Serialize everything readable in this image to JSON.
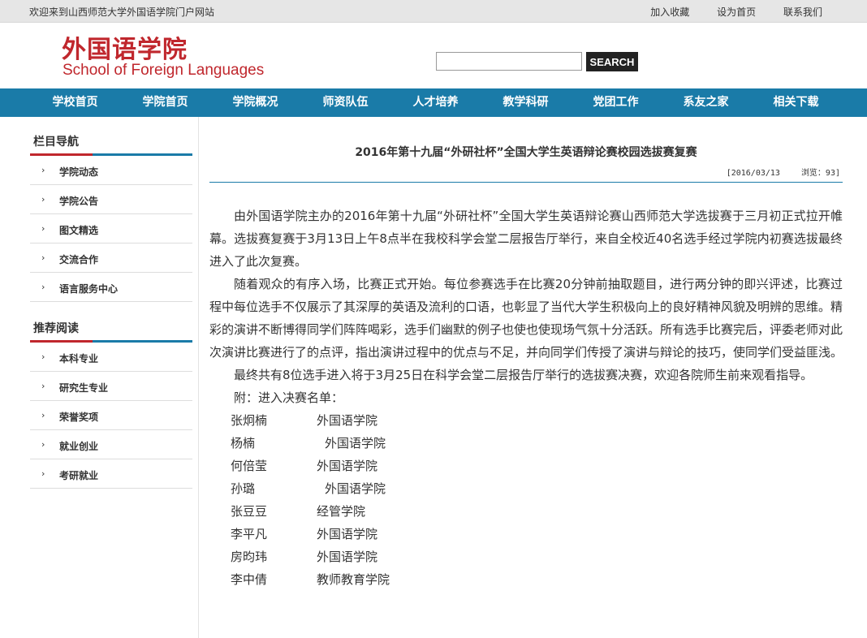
{
  "topbar": {
    "welcome": "欢迎来到山西师范大学外国语学院门户网站",
    "links": [
      "加入收藏",
      "设为首页",
      "联系我们"
    ]
  },
  "header": {
    "logo_cn": "外国语学院",
    "logo_en": "School of Foreign Languages",
    "search_value": "",
    "search_button": "SEARCH"
  },
  "nav": {
    "items": [
      "学校首页",
      "学院首页",
      "学院概况",
      "师资队伍",
      "人才培养",
      "教学科研",
      "党团工作",
      "系友之家",
      "相关下载"
    ]
  },
  "sidebar": {
    "section1_title": "栏目导航",
    "section1_items": [
      "学院动态",
      "学院公告",
      "图文精选",
      "交流合作",
      "语言服务中心"
    ],
    "section2_title": "推荐阅读",
    "section2_items": [
      "本科专业",
      "研究生专业",
      "荣誉奖项",
      "就业创业",
      "考研就业"
    ],
    "arrow": "›"
  },
  "article": {
    "title": "2016年第十九届“外研社杯”全国大学生英语辩论赛校园选拔赛复赛",
    "date": "[2016/03/13",
    "views": "浏览：93]",
    "paragraphs": [
      "由外国语学院主办的2016年第十九届“外研社杯”全国大学生英语辩论赛山西师范大学选拔赛于三月初正式拉开帷幕。选拔赛复赛于3月13日上午8点半在我校科学会堂二层报告厅举行，来自全校近40名选手经过学院内初赛选拔最终进入了此次复赛。",
      "随着观众的有序入场，比赛正式开始。每位参赛选手在比赛20分钟前抽取题目，进行两分钟的即兴评述，比赛过程中每位选手不仅展示了其深厚的英语及流利的口语，也彰显了当代大学生积极向上的良好精神风貌及明辨的思维。精彩的演讲不断博得同学们阵阵喝彩，选手们幽默的例子也使也使现场气氛十分活跃。所有选手比赛完后，评委老师对此次演讲比赛进行了的点评，指出演讲过程中的优点与不足，并向同学们传授了演讲与辩论的技巧，使同学们受益匪浅。",
      "最终共有8位选手进入将于3月25日在科学会堂二层报告厅举行的选拔赛决赛，欢迎各院师生前来观看指导。"
    ],
    "list_heading": "附：进入决赛名单：",
    "finalists": [
      {
        "name": "张炯楠",
        "college": "外国语学院"
      },
      {
        "name": "杨楠",
        "college": "外国语学院"
      },
      {
        "name": "何倍莹",
        "college": "外国语学院"
      },
      {
        "name": "孙璐",
        "college": "外国语学院"
      },
      {
        "name": "张豆豆",
        "college": "经管学院"
      },
      {
        "name": "李平凡",
        "college": "外国语学院"
      },
      {
        "name": "房昀玮",
        "college": "外国语学院"
      },
      {
        "name": "李中倩",
        "college": "教师教育学院"
      }
    ]
  }
}
